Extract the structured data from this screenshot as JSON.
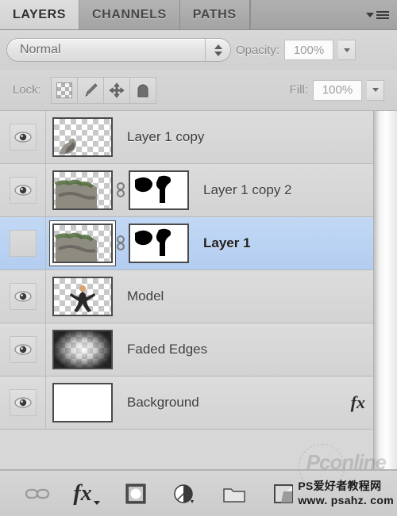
{
  "panel": {
    "tabs": [
      {
        "label": "LAYERS",
        "active": true
      },
      {
        "label": "CHANNELS",
        "active": false
      },
      {
        "label": "PATHS",
        "active": false
      }
    ],
    "menu_icon": "panel-menu-icon"
  },
  "blend": {
    "mode": "Normal",
    "opacity_label": "Opacity:",
    "opacity_value": "100%"
  },
  "lock": {
    "label": "Lock:",
    "buttons": [
      {
        "name": "lock-transparent-pixels",
        "icon": "checkerboard-icon"
      },
      {
        "name": "lock-image-pixels",
        "icon": "paintbrush-icon"
      },
      {
        "name": "lock-position",
        "icon": "move-icon"
      },
      {
        "name": "lock-all",
        "icon": "lock-icon"
      }
    ],
    "fill_label": "Fill:",
    "fill_value": "100%"
  },
  "layers": [
    {
      "name": "Layer 1 copy",
      "visible": true,
      "selected": false,
      "has_mask": false,
      "linked": false,
      "thumb": "transparent-photo",
      "fx": false,
      "expand": false
    },
    {
      "name": "Layer 1 copy 2",
      "visible": true,
      "selected": false,
      "has_mask": true,
      "linked": true,
      "thumb": "transparent-photo",
      "fx": false,
      "expand": false
    },
    {
      "name": "Layer 1",
      "visible": false,
      "selected": true,
      "has_mask": true,
      "linked": true,
      "thumb": "transparent-photo",
      "fx": false,
      "expand": false
    },
    {
      "name": "Model",
      "visible": true,
      "selected": false,
      "has_mask": false,
      "linked": false,
      "thumb": "transparent-figure",
      "fx": false,
      "expand": false
    },
    {
      "name": "Faded Edges",
      "visible": true,
      "selected": false,
      "has_mask": false,
      "linked": false,
      "thumb": "vignette",
      "fx": false,
      "expand": false
    },
    {
      "name": "Background",
      "visible": true,
      "selected": false,
      "has_mask": false,
      "linked": false,
      "thumb": "white",
      "fx": true,
      "fx_label": "fx",
      "expand": true
    }
  ],
  "toolbar": [
    {
      "name": "link-layers-button",
      "icon": "link-icon"
    },
    {
      "name": "layer-style-button",
      "icon": "fx-icon",
      "label": "fx"
    },
    {
      "name": "add-layer-mask-button",
      "icon": "mask-icon"
    },
    {
      "name": "new-adjustment-layer-button",
      "icon": "adjustment-icon"
    },
    {
      "name": "new-group-button",
      "icon": "folder-icon"
    },
    {
      "name": "new-layer-button",
      "icon": "new-layer-icon"
    }
  ],
  "watermark": {
    "ghost": "Pconline",
    "line1": "PS爱好者教程网",
    "line2": "www. psahz. com"
  }
}
